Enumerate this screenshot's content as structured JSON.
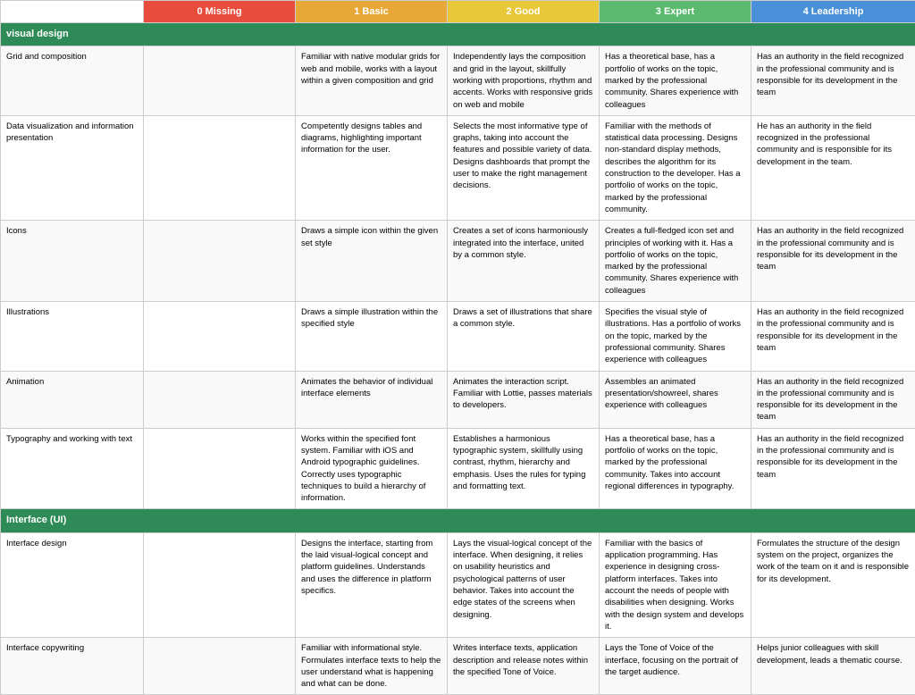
{
  "header": {
    "skill_label": "",
    "col0_label": "0 Missing",
    "col1_label": "1 Basic",
    "col2_label": "2 Good",
    "col3_label": "3 Expert",
    "col4_label": "4 Leadership"
  },
  "sections": [
    {
      "title": "visual design",
      "rows": [
        {
          "skill": "Grid and composition",
          "col0": "",
          "col1": "Familiar with native modular grids for web and mobile, works with a layout within a given composition and grid",
          "col2": "Independently lays the composition and grid in the layout, skillfully working with proportions, rhythm and accents. Works with responsive grids on web and mobile",
          "col3": "Has a theoretical base, has a portfolio of works on the topic, marked by the professional community. Shares experience with colleagues",
          "col4": "Has an authority in the field recognized in the professional community and is responsible for its development in the team"
        },
        {
          "skill": "Data visualization and information presentation",
          "col0": "",
          "col1": "Competently designs tables and diagrams, highlighting important information for the user.",
          "col2": "Selects the most informative type of graphs, taking into account the features and possible variety of data. Designs dashboards that prompt the user to make the right management decisions.",
          "col3": "Familiar with the methods of statistical data processing. Designs non-standard display methods, describes the algorithm for its construction to the developer. Has a portfolio of works on the topic, marked by the professional community.",
          "col4": "He has an authority in the field recognized in the professional community and is responsible for its development in the team."
        },
        {
          "skill": "Icons",
          "col0": "",
          "col1": "Draws a simple icon within the given set style",
          "col2": "Creates a set of icons harmoniously integrated into the interface, united by a common style.",
          "col3": "Creates a full-fledged icon set and principles of working with it. Has a portfolio of works on the topic, marked by the professional community. Shares experience with colleagues",
          "col4": "Has an authority in the field recognized in the professional community and is responsible for its development in the team"
        },
        {
          "skill": "Illustrations",
          "col0": "",
          "col1": "Draws a simple illustration within the specified style",
          "col2": "Draws a set of illustrations that share a common style.",
          "col3": "Specifies the visual style of illustrations. Has a portfolio of works on the topic, marked by the professional community. Shares experience with colleagues",
          "col4": "Has an authority in the field recognized in the professional community and is responsible for its development in the team"
        },
        {
          "skill": "Animation",
          "col0": "",
          "col1": "Animates the behavior of individual interface elements",
          "col2": "Animates the interaction script. Familiar with Lottie, passes materials to developers.",
          "col3": "Assembles an animated presentation/showreel, shares experience with colleagues",
          "col4": "Has an authority in the field recognized in the professional community and is responsible for its development in the team"
        },
        {
          "skill": "Typography and working with text",
          "col0": "",
          "col1": "Works within the specified font system. Familiar with iOS and Android typographic guidelines. Correctly uses typographic techniques to build a hierarchy of information.",
          "col2": "Establishes a harmonious typographic system, skillfully using contrast, rhythm, hierarchy and emphasis. Uses the rules for typing and formatting text.",
          "col3": "Has a theoretical base, has a portfolio of works on the topic, marked by the professional community. Takes into account regional differences in typography.",
          "col4": "Has an authority in the field recognized in the professional community and is responsible for its development in the team"
        }
      ]
    },
    {
      "title": "Interface (UI)",
      "rows": [
        {
          "skill": "Interface design",
          "col0": "",
          "col1": "Designs the interface, starting from the laid visual-logical concept and platform guidelines. Understands and uses the difference in platform specifics.",
          "col2": "Lays the visual-logical concept of the interface. When designing, it relies on usability heuristics and psychological patterns of user behavior. Takes into account the edge states of the screens when designing.",
          "col3": "Familiar with the basics of application programming. Has experience in designing cross-platform interfaces. Takes into account the needs of people with disabilities when designing. Works with the design system and develops it.",
          "col4": "Formulates the structure of the design system on the project, organizes the work of the team on it and is responsible for its development."
        },
        {
          "skill": "Interface copywriting",
          "col0": "",
          "col1": "Familiar with informational style. Formulates interface texts to help the user understand what is happening and what can be done.",
          "col2": "Writes interface texts, application description and release notes within the specified Tone of Voice.",
          "col3": "Lays the Tone of Voice of the interface, focusing on the portrait of the target audience.",
          "col4": "Helps junior colleagues with skill development, leads a thematic course."
        }
      ]
    }
  ]
}
